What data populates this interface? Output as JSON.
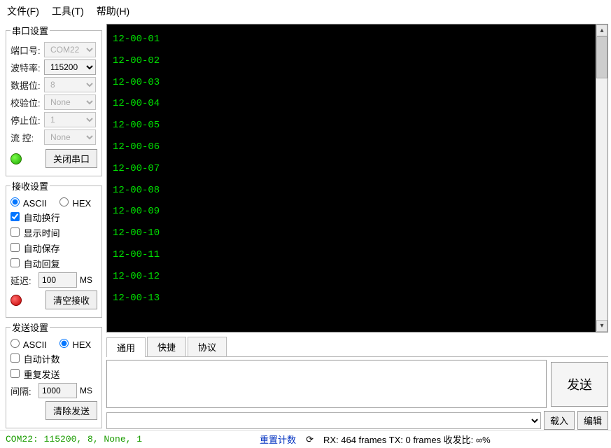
{
  "menu": {
    "file": "文件(F)",
    "tools": "工具(T)",
    "help": "帮助(H)"
  },
  "serial": {
    "legend": "串口设置",
    "port_lbl": "端口号:",
    "port": "COM22",
    "baud_lbl": "波特率:",
    "baud": "115200",
    "data_lbl": "数据位:",
    "data": "8",
    "parity_lbl": "校验位:",
    "parity": "None",
    "stop_lbl": "停止位:",
    "stop": "1",
    "flow_lbl": "流  控:",
    "flow": "None",
    "close_btn": "关闭串口"
  },
  "recv": {
    "legend": "接收设置",
    "ascii": "ASCII",
    "hex": "HEX",
    "wrap": "自动换行",
    "time": "显示时间",
    "save": "自动保存",
    "reply": "自动回复",
    "delay_lbl": "延迟:",
    "delay": "100",
    "unit": "MS",
    "clear_btn": "清空接收"
  },
  "send": {
    "legend": "发送设置",
    "ascii": "ASCII",
    "hex": "HEX",
    "count": "自动计数",
    "repeat": "重复发送",
    "interval_lbl": "间隔:",
    "interval": "1000",
    "unit": "MS",
    "clear_btn": "清除发送"
  },
  "terminal_lines": [
    "12-00-01",
    "12-00-02",
    "12-00-03",
    "12-00-04",
    "12-00-05",
    "12-00-06",
    "12-00-07",
    "12-00-08",
    "12-00-09",
    "12-00-10",
    "12-00-11",
    "12-00-12",
    "12-00-13"
  ],
  "tabs": {
    "general": "通用",
    "shortcut": "快捷",
    "protocol": "协议"
  },
  "sendbtn": "发送",
  "loadbtn": "载入",
  "editbtn": "编辑",
  "status": {
    "port": "COM22: 115200, 8, None, 1",
    "reset": "重置计数",
    "stats": "RX: 464 frames  TX: 0 frames  收发比:  ∞%"
  }
}
